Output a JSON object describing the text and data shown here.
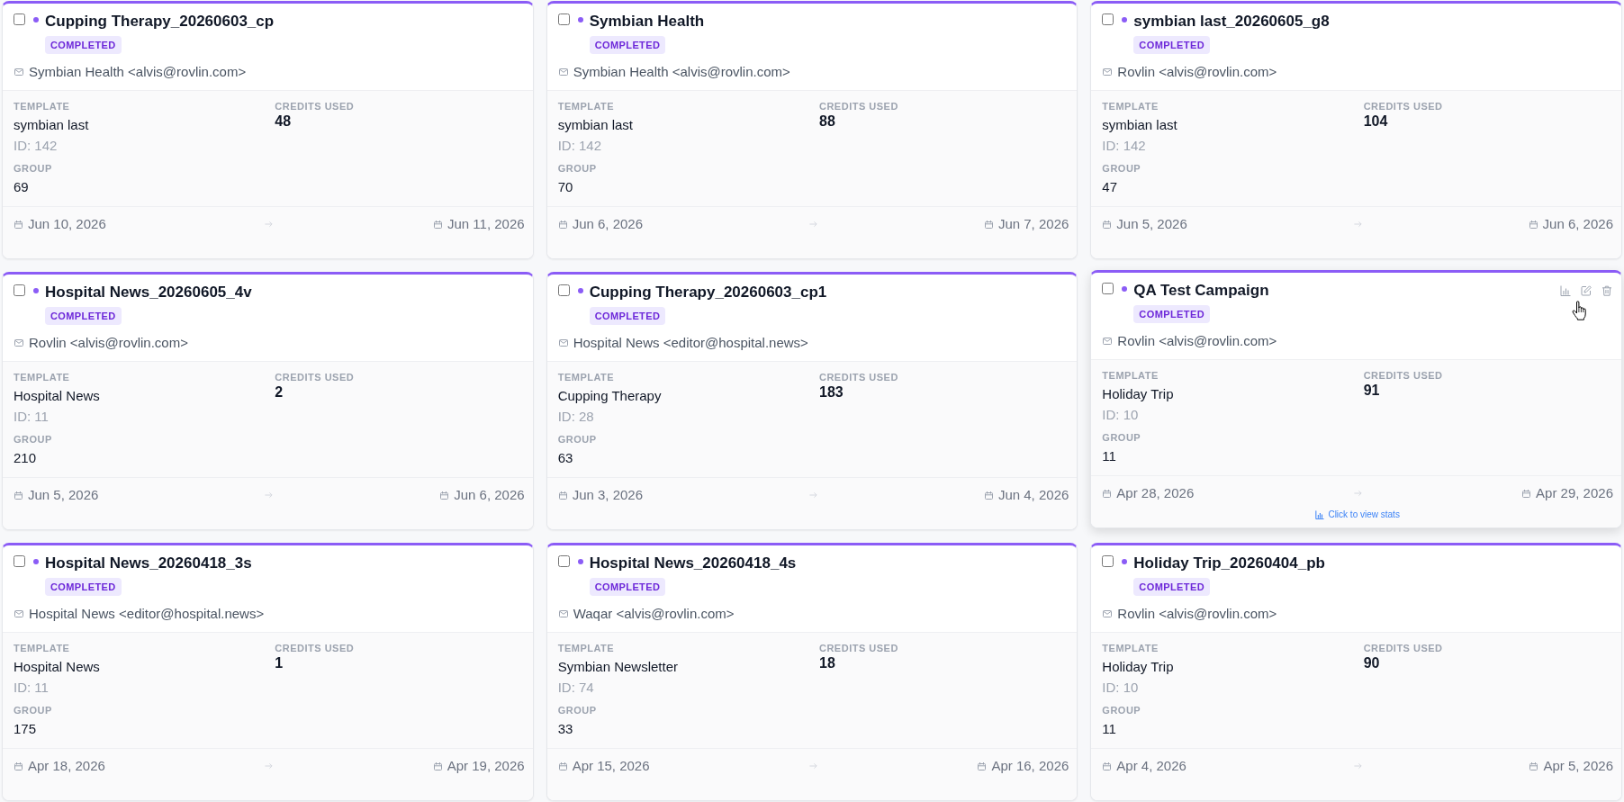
{
  "campaigns": [
    {
      "title": "Cupping Therapy_20260603_cp",
      "checked": false,
      "hovered": false,
      "status": "COMPLETED",
      "sender": "Symbian Health <alvis@rovlin.com>",
      "template": {
        "label": "TEMPLATE",
        "name": "symbian last",
        "id": "ID: 142"
      },
      "credits": {
        "label": "CREDITS USED",
        "value": "48"
      },
      "group": {
        "label": "GROUP",
        "value": "69"
      },
      "start": "Jun 10, 2026",
      "end": "Jun 11, 2026"
    },
    {
      "title": "Symbian Health",
      "checked": false,
      "hovered": false,
      "status": "COMPLETED",
      "sender": "Symbian Health <alvis@rovlin.com>",
      "template": {
        "label": "TEMPLATE",
        "name": "symbian last",
        "id": "ID: 142"
      },
      "credits": {
        "label": "CREDITS USED",
        "value": "88"
      },
      "group": {
        "label": "GROUP",
        "value": "70"
      },
      "start": "Jun 6, 2026",
      "end": "Jun 7, 2026"
    },
    {
      "title": "symbian last_20260605_g8",
      "checked": false,
      "hovered": false,
      "status": "COMPLETED",
      "sender": "Rovlin <alvis@rovlin.com>",
      "template": {
        "label": "TEMPLATE",
        "name": "symbian last",
        "id": "ID: 142"
      },
      "credits": {
        "label": "CREDITS USED",
        "value": "104"
      },
      "group": {
        "label": "GROUP",
        "value": "47"
      },
      "start": "Jun 5, 2026",
      "end": "Jun 6, 2026"
    },
    {
      "title": "Hospital News_20260605_4v",
      "checked": false,
      "hovered": false,
      "status": "COMPLETED",
      "sender": "Rovlin <alvis@rovlin.com>",
      "template": {
        "label": "TEMPLATE",
        "name": "Hospital News",
        "id": "ID: 11"
      },
      "credits": {
        "label": "CREDITS USED",
        "value": "2"
      },
      "group": {
        "label": "GROUP",
        "value": "210"
      },
      "start": "Jun 5, 2026",
      "end": "Jun 6, 2026"
    },
    {
      "title": "Cupping Therapy_20260603_cp1",
      "checked": false,
      "hovered": false,
      "status": "COMPLETED",
      "sender": "Hospital News <editor@hospital.news>",
      "template": {
        "label": "TEMPLATE",
        "name": "Cupping Therapy",
        "id": "ID: 28"
      },
      "credits": {
        "label": "CREDITS USED",
        "value": "183"
      },
      "group": {
        "label": "GROUP",
        "value": "63"
      },
      "start": "Jun 3, 2026",
      "end": "Jun 4, 2026"
    },
    {
      "title": "QA Test Campaign",
      "checked": false,
      "hovered": true,
      "status": "COMPLETED",
      "sender": "Rovlin <alvis@rovlin.com>",
      "template": {
        "label": "TEMPLATE",
        "name": "Holiday Trip",
        "id": "ID: 10"
      },
      "credits": {
        "label": "CREDITS USED",
        "value": "91"
      },
      "group": {
        "label": "GROUP",
        "value": "11"
      },
      "start": "Apr 28, 2026",
      "end": "Apr 29, 2026",
      "stats_link": "Click to view stats"
    },
    {
      "title": "Hospital News_20260418_3s",
      "checked": false,
      "hovered": false,
      "status": "COMPLETED",
      "sender": "Hospital News <editor@hospital.news>",
      "template": {
        "label": "TEMPLATE",
        "name": "Hospital News",
        "id": "ID: 11"
      },
      "credits": {
        "label": "CREDITS USED",
        "value": "1"
      },
      "group": {
        "label": "GROUP",
        "value": "175"
      },
      "start": "Apr 18, 2026",
      "end": "Apr 19, 2026"
    },
    {
      "title": "Hospital News_20260418_4s",
      "checked": false,
      "hovered": false,
      "status": "COMPLETED",
      "sender": "Waqar <alvis@rovlin.com>",
      "template": {
        "label": "TEMPLATE",
        "name": "Symbian Newsletter",
        "id": "ID: 74"
      },
      "credits": {
        "label": "CREDITS USED",
        "value": "18"
      },
      "group": {
        "label": "GROUP",
        "value": "33"
      },
      "start": "Apr 15, 2026",
      "end": "Apr 16, 2026"
    },
    {
      "title": "Holiday Trip_20260404_pb",
      "checked": false,
      "hovered": false,
      "status": "COMPLETED",
      "sender": "Rovlin <alvis@rovlin.com>",
      "template": {
        "label": "TEMPLATE",
        "name": "Holiday Trip",
        "id": "ID: 10"
      },
      "credits": {
        "label": "CREDITS USED",
        "value": "90"
      },
      "group": {
        "label": "GROUP",
        "value": "11"
      },
      "start": "Apr 4, 2026",
      "end": "Apr 5, 2026"
    }
  ]
}
